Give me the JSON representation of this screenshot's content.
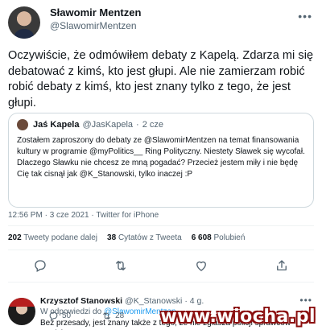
{
  "tweet": {
    "author_name": "Sławomir Mentzen",
    "author_handle": "@SlawomirMentzen",
    "text": "Oczywiście, że odmówiłem debaty z Kapelą. Zdarza mi się debatować z kimś, kto jest głupi. Ale nie zamierzam robić robić debaty z kimś, kto jest znany tylko z tego, że jest głupi.",
    "timestamp": "12:56 PM · 3 cze 2021 · Twitter for iPhone",
    "more_icon": "ellipsis-icon"
  },
  "quote": {
    "author_name": "Jaś Kapela",
    "author_handle": "@JasKapela",
    "dot": "·",
    "time": "2 cze",
    "text": "Zostałem zaproszony do debaty ze @SlawomirMentzen  na temat finansowania kultury w programie @myPolitics__  Ring Polityczny. Niestety Sławek się wycofał. Dlaczego Sławku nie chcesz ze mną pogadać? Przecież jestem miły i nie będę Cię tak cisnął jak @K_Stanowski, tylko inaczej :P"
  },
  "stats": {
    "retweets_count": "202",
    "retweets_label": "Tweety podane dalej",
    "quotes_count": "38",
    "quotes_label": "Cytatów z Tweeta",
    "likes_count": "6 608",
    "likes_label": "Polubień"
  },
  "actions": [
    "reply-icon",
    "retweet-icon",
    "like-icon",
    "share-icon"
  ],
  "reply": {
    "author_name": "Krzysztof Stanowski",
    "author_handle": "@K_Stanowski",
    "dot": "·",
    "time": "4 g.",
    "reply_prefix": "W odpowiedzi do",
    "reply_to": "@SlawomirMentzen",
    "text": "Bez przesady, jest znany także z tego, że nie zgłasza policji sprawców gwałtów.",
    "replies_count": "50",
    "retweets_count": "28"
  },
  "watermark": "www.wiocha.pl",
  "colors": {
    "link": "#1d9bf0",
    "secondary": "#536471",
    "border": "#cfd9de",
    "watermark_outline": "#8b0f0f"
  }
}
